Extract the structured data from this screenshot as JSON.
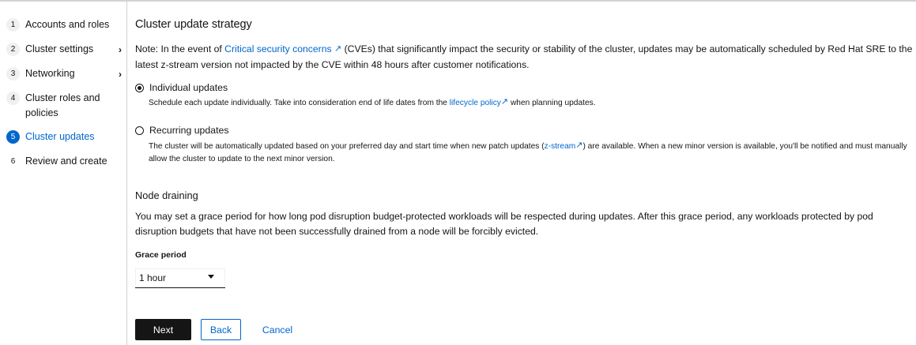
{
  "wizard": {
    "steps": [
      {
        "number": "1",
        "label": "Accounts and roles",
        "chevron": ""
      },
      {
        "number": "2",
        "label": "Cluster settings",
        "chevron": "›"
      },
      {
        "number": "3",
        "label": "Networking",
        "chevron": "›"
      },
      {
        "number": "4",
        "label": "Cluster roles and policies",
        "chevron": ""
      },
      {
        "number": "5",
        "label": "Cluster updates",
        "chevron": ""
      },
      {
        "number": "6",
        "label": "Review and create",
        "chevron": ""
      }
    ],
    "active_step": 5
  },
  "update_strategy": {
    "title": "Cluster update strategy",
    "note_prefix": "Note: In the event of ",
    "note_link": "Critical security concerns",
    "note_suffix": " (CVEs) that significantly impact the security or stability of the cluster, updates may be automatically scheduled by Red Hat SRE to the latest z-stream version not impacted by the CVE within 48 hours after customer notifications.",
    "options": {
      "individual": {
        "label": "Individual updates",
        "selected": true,
        "desc_prefix": "Schedule each update individually. Take into consideration end of life dates from the ",
        "desc_link": "lifecycle policy",
        "desc_suffix": " when planning updates."
      },
      "recurring": {
        "label": "Recurring updates",
        "selected": false,
        "desc_prefix": "The cluster will be automatically updated based on your preferred day and start time when new patch updates (",
        "desc_link": "z-stream",
        "desc_suffix": ") are available. When a new minor version is available, you'll be notified and must manually allow the cluster to update to the next minor version."
      }
    }
  },
  "node_draining": {
    "title": "Node draining",
    "description": "You may set a grace period for how long pod disruption budget-protected workloads will be respected during updates. After this grace period, any workloads protected by pod disruption budgets that have not been successfully drained from a node will be forcibly evicted.",
    "grace_label": "Grace period",
    "grace_value": "1 hour"
  },
  "footer": {
    "next": "Next",
    "back": "Back",
    "cancel": "Cancel"
  },
  "icons": {
    "external_link": "external-link-icon",
    "caret": "caret-down-icon"
  },
  "colors": {
    "accent": "#0066cc",
    "text": "#151515",
    "primary_button": "#151515"
  }
}
